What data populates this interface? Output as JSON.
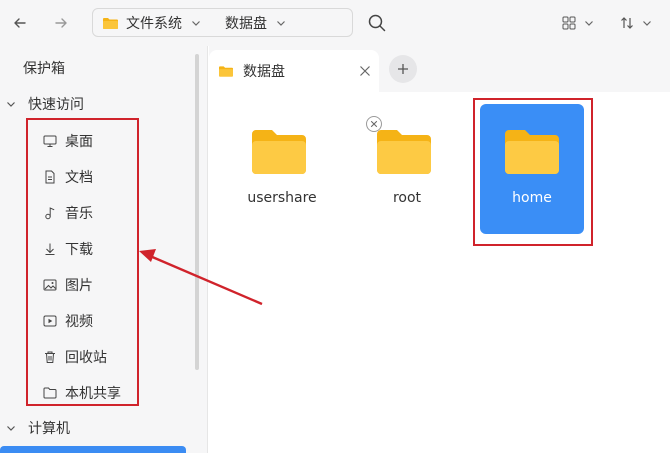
{
  "toolbar": {
    "breadcrumbs": [
      {
        "label": "文件系统"
      },
      {
        "label": "数据盘"
      }
    ],
    "icons": {
      "back": "arrow-left-icon",
      "forward": "arrow-right-icon",
      "search": "search-icon",
      "view": "grid-view-icon",
      "sort": "sort-icon"
    }
  },
  "sidebar": {
    "vault": {
      "label": "保护箱"
    },
    "quick_access": {
      "label": "快速访问",
      "items": [
        {
          "label": "桌面",
          "icon": "desktop-icon"
        },
        {
          "label": "文档",
          "icon": "document-icon"
        },
        {
          "label": "音乐",
          "icon": "music-icon"
        },
        {
          "label": "下载",
          "icon": "download-icon"
        },
        {
          "label": "图片",
          "icon": "picture-icon"
        },
        {
          "label": "视频",
          "icon": "video-icon"
        },
        {
          "label": "回收站",
          "icon": "trash-icon"
        },
        {
          "label": "本机共享",
          "icon": "folder-share-icon"
        }
      ]
    },
    "computer": {
      "label": "计算机"
    }
  },
  "tabs": [
    {
      "label": "数据盘",
      "active": true
    }
  ],
  "files": [
    {
      "name": "usershare",
      "selected": false,
      "locked": false
    },
    {
      "name": "root",
      "selected": false,
      "locked": true
    },
    {
      "name": "home",
      "selected": true,
      "locked": false
    }
  ],
  "colors": {
    "accent": "#3a8ef6",
    "folder": "#fbc53a",
    "annotation": "#d0232b"
  }
}
